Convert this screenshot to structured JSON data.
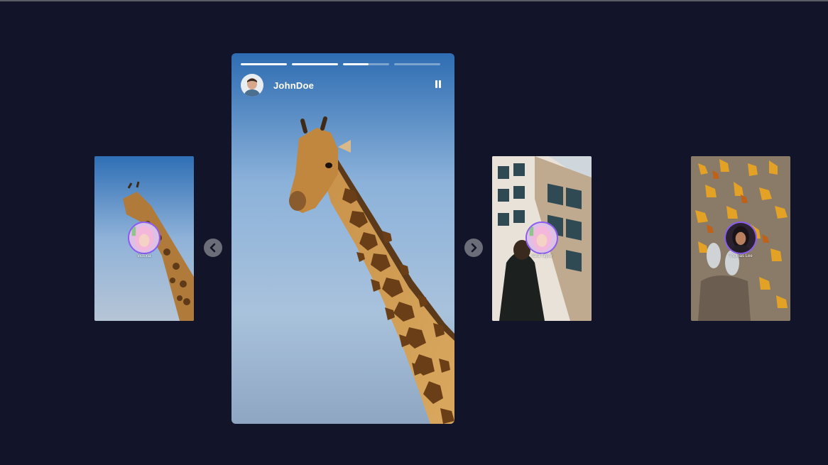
{
  "main_story": {
    "username": "JohnDoe",
    "progress": [
      1.0,
      1.0,
      0.55,
      0.0
    ],
    "pause_icon": "pause-icon",
    "image": "giraffe"
  },
  "preview_cards": [
    {
      "username": "victoria",
      "image": "giraffe",
      "avatar": "pink-haired-woman"
    },
    {
      "username": "Sara Taylor",
      "image": "building-with-person",
      "avatar": "pink-haired-woman"
    },
    {
      "username": "Thomas Lee",
      "image": "autumn-leaves",
      "avatar": "dark-haired-woman"
    }
  ],
  "navigation": {
    "prev_icon": "chevron-left-icon",
    "next_icon": "chevron-right-icon"
  },
  "colors": {
    "background": "#12142a",
    "avatar_ring": "#8c5cf0",
    "nav_button": "#6b6d78"
  }
}
